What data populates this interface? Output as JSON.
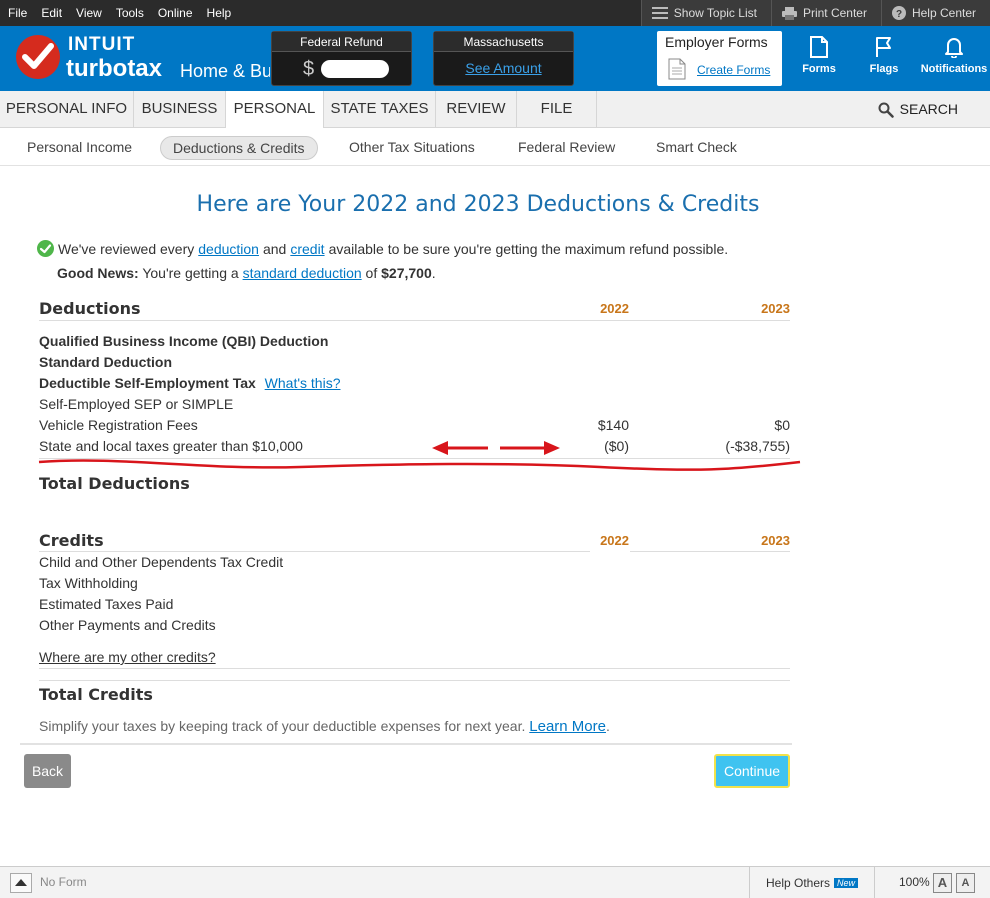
{
  "menubar": {
    "items": [
      "File",
      "Edit",
      "View",
      "Tools",
      "Online",
      "Help"
    ]
  },
  "topbar": {
    "show_topic_list": "Show Topic List",
    "print_center": "Print Center",
    "help_center": "Help Center"
  },
  "brand": {
    "intuit": "INTUIT",
    "turbotax": "turbotax",
    "edition": "Home & Business"
  },
  "refund": {
    "federal_title": "Federal Refund",
    "federal_dollar": "$",
    "state_title": "Massachusetts",
    "state_link": "See Amount"
  },
  "employer": {
    "title": "Employer Forms",
    "link": "Create Forms"
  },
  "header_icons": {
    "forms": "Forms",
    "flags": "Flags",
    "notifications": "Notifications"
  },
  "tabs": [
    "PERSONAL INFO",
    "BUSINESS",
    "PERSONAL",
    "STATE TAXES",
    "REVIEW",
    "FILE"
  ],
  "search_label": "SEARCH",
  "subtabs": [
    "Personal Income",
    "Deductions & Credits",
    "Other Tax Situations",
    "Federal Review",
    "Smart Check"
  ],
  "page": {
    "title": "Here are Your 2022 and 2023 Deductions & Credits",
    "review": {
      "prefix": "We've reviewed every",
      "link1": "deduction",
      "mid": "and",
      "link2": "credit",
      "suffix": "available to be sure you're getting the maximum refund possible."
    },
    "good_news": {
      "label": "Good News:",
      "text": "You're getting a",
      "link": "standard deduction",
      "of": "of",
      "amount": "$27,700",
      "period": "."
    }
  },
  "deductions": {
    "heading": "Deductions",
    "year1": "2022",
    "year2": "2023",
    "rows": [
      {
        "label": "Qualified Business Income (QBI) Deduction",
        "v1": "",
        "v2": ""
      },
      {
        "label": "Standard Deduction",
        "v1": "",
        "v2": ""
      },
      {
        "label": "Deductible Self-Employment Tax",
        "link": "What's this?",
        "v1": "",
        "v2": ""
      },
      {
        "label": "Self-Employed SEP or SIMPLE",
        "v1": "",
        "v2": ""
      },
      {
        "label": "Vehicle Registration Fees",
        "v1": "$140",
        "v2": "$0"
      },
      {
        "label": "State and local taxes greater than $10,000",
        "v1": "($0)",
        "v2": "(-$38,755)"
      }
    ],
    "total_label": "Total Deductions"
  },
  "credits": {
    "heading": "Credits",
    "year1": "2022",
    "year2": "2023",
    "rows": [
      {
        "label": "Child and Other Dependents Tax Credit"
      },
      {
        "label": "Tax Withholding"
      },
      {
        "label": "Estimated Taxes Paid"
      },
      {
        "label": "Other Payments and Credits"
      }
    ],
    "other_link": "Where are my other credits?",
    "total_label": "Total Credits"
  },
  "footer": {
    "simplify": "Simplify your taxes by keeping track of your deductible expenses for next year.",
    "learn_more": "Learn More",
    "period": ".",
    "back": "Back",
    "continue": "Continue"
  },
  "statusbar": {
    "no_form": "No Form",
    "help_others": "Help Others",
    "new_badge": "New",
    "zoom": "100%",
    "a1": "A",
    "a2": "A"
  },
  "colors": {
    "brand_blue": "#0077c5",
    "title_blue": "#1a6fae",
    "year_orange": "#c8761a",
    "annotation_red": "#d8151b",
    "continue_cyan": "#3fc3f0"
  }
}
